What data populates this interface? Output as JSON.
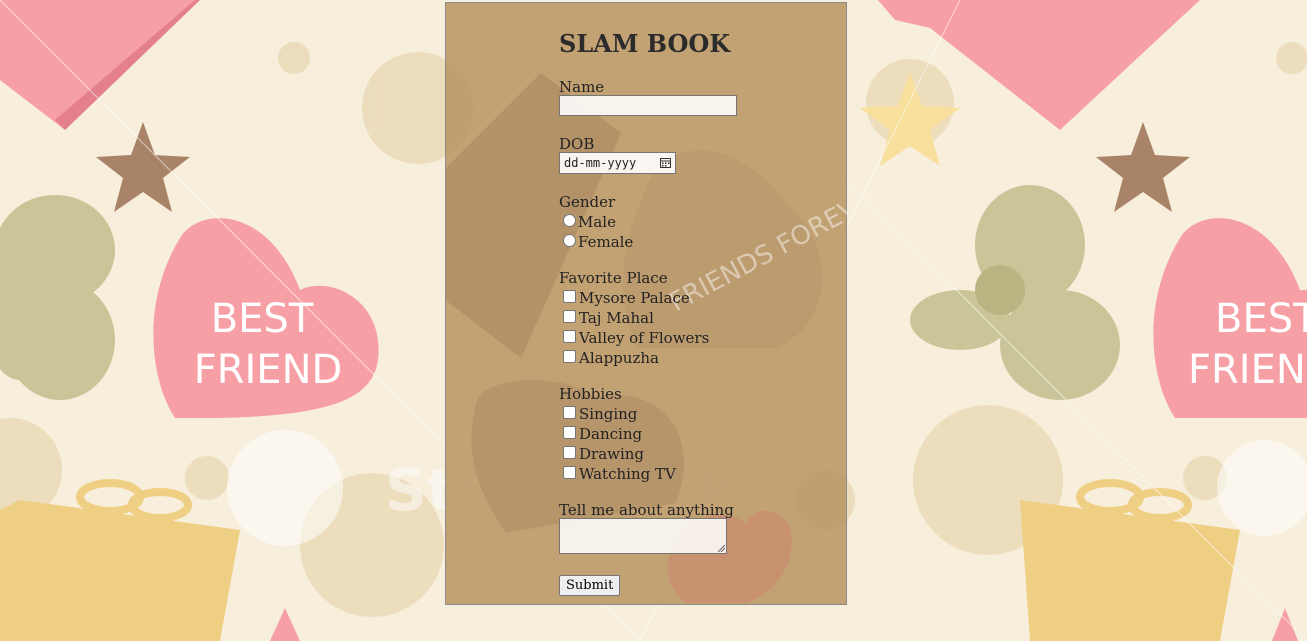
{
  "form": {
    "title": "SLAM BOOK",
    "name_label": "Name",
    "name_value": "",
    "dob_label": "DOB",
    "dob_placeholder": "dd-mm-yyyy",
    "gender_label": "Gender",
    "gender_options": [
      "Male",
      "Female"
    ],
    "place_label": "Favorite Place",
    "place_options": [
      "Mysore Palace",
      "Taj Mahal",
      "Valley of Flowers",
      "Alappuzha"
    ],
    "hobbies_label": "Hobbies",
    "hobby_options": [
      "Singing",
      "Dancing",
      "Drawing",
      "Watching TV"
    ],
    "about_label": "Tell me about anything",
    "about_value": "",
    "submit_label": "Submit"
  },
  "background": {
    "heart_text_line1": "BEST",
    "heart_text_line2": "FRIEND",
    "watermark": "Storyblocks",
    "heart2_text": "FRIENDS FOREVER",
    "colors": {
      "base": "#f7eedb",
      "pink": "#f6a0a6",
      "tan": "#b69060",
      "olive": "#c9c598",
      "gold": "#efcf83",
      "brown": "#a98368"
    }
  }
}
